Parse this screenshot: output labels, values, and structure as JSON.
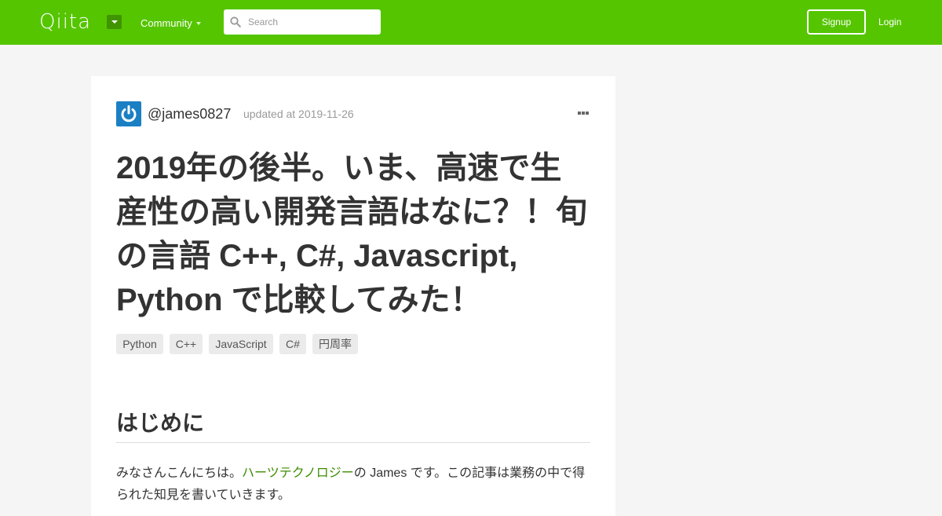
{
  "header": {
    "logo_text": "Qiita",
    "logo_dropdown_icon": "caret-down-icon",
    "community_label": "Community",
    "search_placeholder": "Search",
    "search_value": "",
    "signup_label": "Signup",
    "login_label": "Login",
    "brand_color": "#55c500"
  },
  "article": {
    "author": "@james0827",
    "updated": "updated at 2019-11-26",
    "title": "2019年の後半。いま、高速で生産性の高い開発言語はなに？！旬の言語 C++, C#, Javascript, Python で比較してみた！",
    "tags": [
      "Python",
      "C++",
      "JavaScript",
      "C#",
      "円周率"
    ],
    "section_heading": "はじめに",
    "intro_prefix": "みなさんこんにちは。",
    "intro_link": "ハーツテクノロジー",
    "intro_suffix": "の James です。この記事は業務の中で得られた知見を書いていきます。",
    "link_color": "#3b8d00"
  }
}
